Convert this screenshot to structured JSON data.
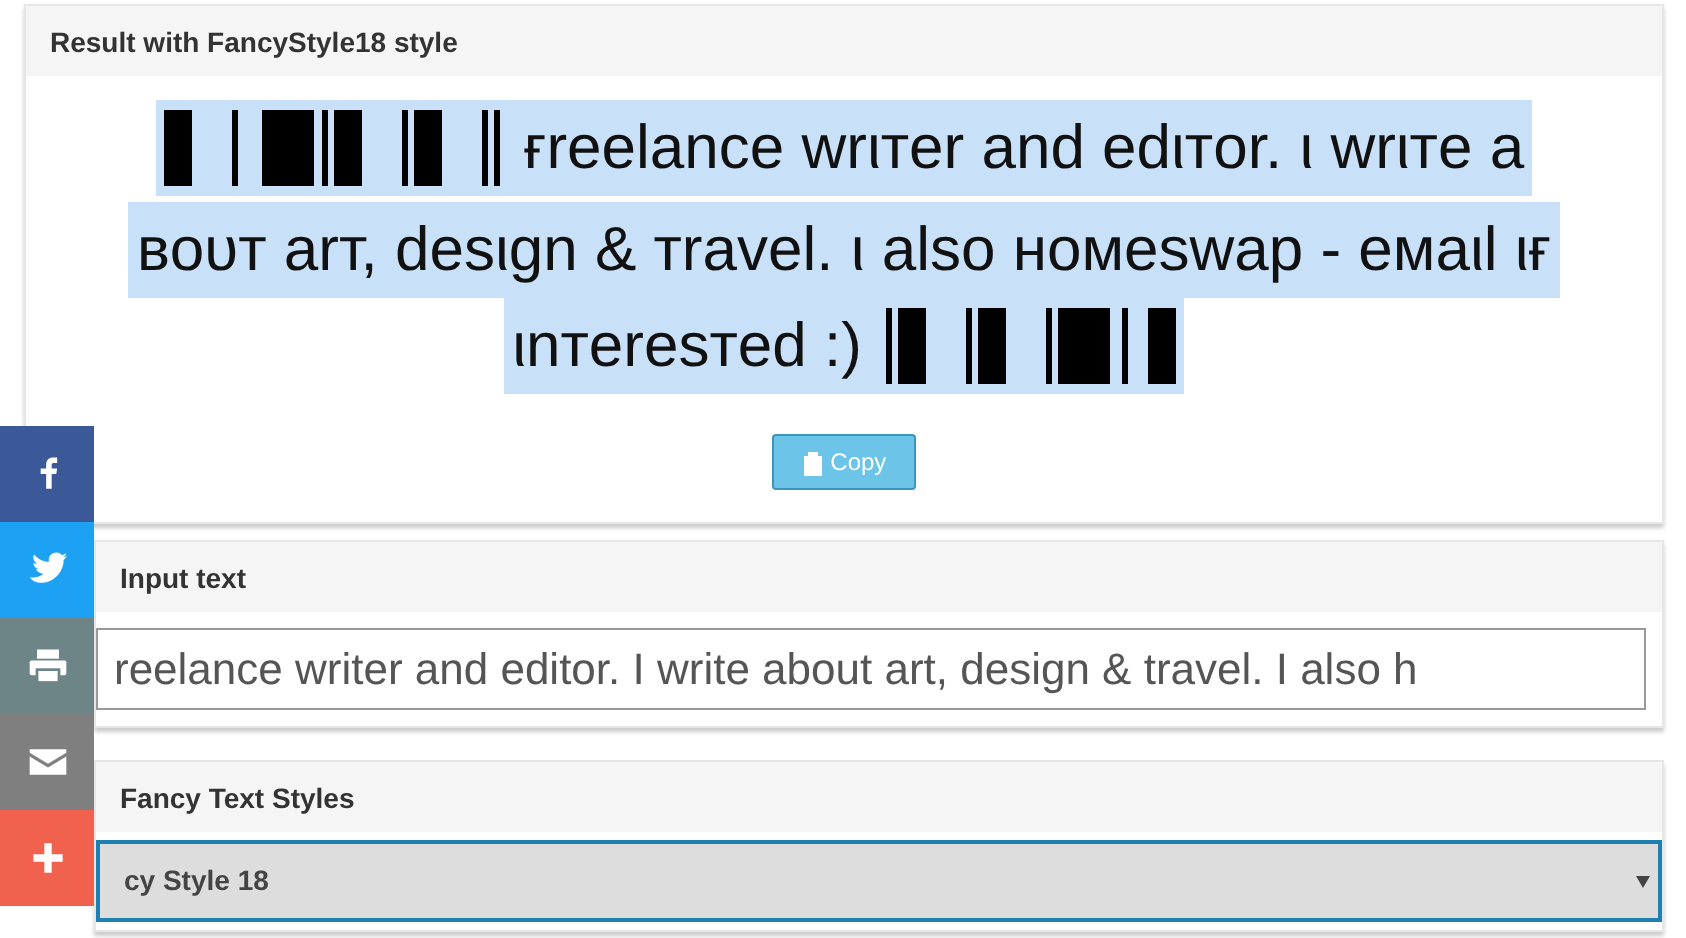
{
  "result_panel": {
    "title": "Result with FancyStyle18 style",
    "lines": [
      {
        "text": "ғreelance wrιтer and edιтor. ι wrιтe a",
        "bars_before": true,
        "bars_after": false
      },
      {
        "text": "вoυт arт, deѕιgn & тravel. ι also нoмeѕwap - eмaιl ιғ",
        "bars_before": false,
        "bars_after": false
      },
      {
        "text": "ιnтereѕтed :)",
        "bars_before": false,
        "bars_after": true
      }
    ],
    "copy_button": "Copy"
  },
  "input_panel": {
    "title": "Input text",
    "value": "reelance writer and editor. I write about art, design & travel. I also h"
  },
  "styles_panel": {
    "title": "Fancy Text Styles",
    "selected_style": "cy Style 18"
  },
  "share_bar": [
    {
      "kind": "facebook",
      "color": "#3b5998"
    },
    {
      "kind": "twitter",
      "color": "#1da1f2"
    },
    {
      "kind": "print",
      "color": "#6d8586"
    },
    {
      "kind": "email",
      "color": "#7f7f7f"
    },
    {
      "kind": "more",
      "color": "#f0624d"
    }
  ]
}
